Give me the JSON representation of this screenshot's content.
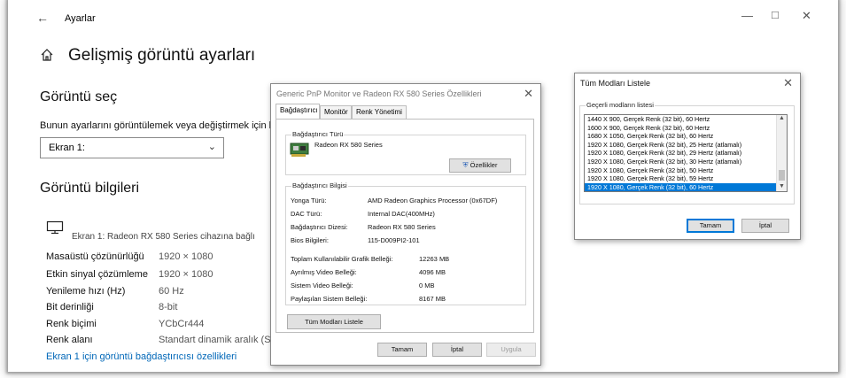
{
  "settings": {
    "title": "Ayarlar",
    "page_title": "Gelişmiş görüntü ayarları",
    "section_display_select": "Görüntü seç",
    "select_desc": "Bunun ayarlarını görüntülemek veya değiştirmek için bir",
    "display_select_value": "Ekran 1:",
    "section_display_info": "Görüntü bilgileri",
    "monitor_desc": "Ekran 1: Radeon RX 580 Series cihazına bağlı",
    "info_rows": [
      {
        "label": "Masaüstü çözünürlüğü",
        "value": "1920 × 1080"
      },
      {
        "label": "Etkin sinyal çözümleme",
        "value": "1920 × 1080"
      },
      {
        "label": "Yenileme hızı (Hz)",
        "value": "60 Hz"
      },
      {
        "label": "Bit derinliği",
        "value": "8-bit"
      },
      {
        "label": "Renk biçimi",
        "value": "YCbCr444"
      },
      {
        "label": "Renk alanı",
        "value": "Standart dinamik aralık (SD"
      }
    ],
    "adapter_link": "Ekran 1 için görüntü bağdaştırıcısı özellikleri"
  },
  "props_dialog": {
    "title": "Generic PnP Monitor ve Radeon RX 580 Series Özellikleri",
    "tabs": [
      "Bağdaştırıcı",
      "Monitör",
      "Renk Yönetimi"
    ],
    "adapter_type_label": "Bağdaştırıcı Türü",
    "adapter_name": "Radeon RX 580 Series",
    "properties_button": "Özellikler",
    "adapter_info_label": "Bağdaştırıcı Bilgisi",
    "info": [
      {
        "label": "Yonga Türü:",
        "value": "AMD Radeon Graphics Processor (0x67DF)"
      },
      {
        "label": "DAC Türü:",
        "value": "Internal DAC(400MHz)"
      },
      {
        "label": "Bağdaştırıcı Dizesi:",
        "value": "Radeon RX 580 Series"
      },
      {
        "label": "Bios Bilgileri:",
        "value": "115-D009PI2-101"
      }
    ],
    "memory": [
      {
        "label": "Toplam Kullanılabilir Grafik Belleği:",
        "value": "12263 MB"
      },
      {
        "label": "Ayrılmış Video Belleği:",
        "value": "4096 MB"
      },
      {
        "label": "Sistem Video Belleği:",
        "value": "0 MB"
      },
      {
        "label": "Paylaşılan Sistem Belleği:",
        "value": "8167 MB"
      }
    ],
    "list_all_modes_button": "Tüm Modları Listele",
    "ok_button": "Tamam",
    "cancel_button": "İptal",
    "apply_button": "Uygula"
  },
  "modes_dialog": {
    "title": "Tüm Modları Listele",
    "group_label": "Geçerli modların listesi",
    "modes": [
      "1440 X 900, Gerçek Renk (32 bit), 60 Hertz",
      "1600 X 900, Gerçek Renk (32 bit), 60 Hertz",
      "1680 X 1050, Gerçek Renk (32 bit), 60 Hertz",
      "1920 X 1080, Gerçek Renk (32 bit), 25 Hertz (atlamalı)",
      "1920 X 1080, Gerçek Renk (32 bit), 29 Hertz (atlamalı)",
      "1920 X 1080, Gerçek Renk (32 bit), 30 Hertz (atlamalı)",
      "1920 X 1080, Gerçek Renk (32 bit), 50 Hertz",
      "1920 X 1080, Gerçek Renk (32 bit), 59 Hertz",
      "1920 X 1080, Gerçek Renk (32 bit), 60 Hertz"
    ],
    "selected_index": 8,
    "ok_button": "Tamam",
    "cancel_button": "İptal"
  },
  "colors": {
    "accent": "#0078d7",
    "link": "#0067b8"
  }
}
